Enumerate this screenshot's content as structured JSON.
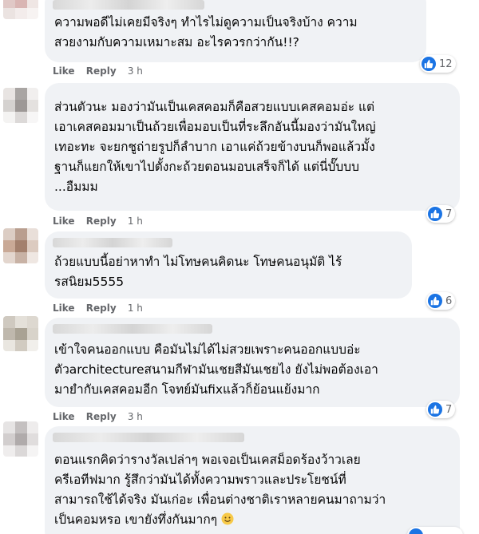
{
  "actions": {
    "like": "Like",
    "reply": "Reply"
  },
  "comments": [
    {
      "text": "ความพอดีไม่เคยมีจริงๆ ทำไรไม่ดูความเป็นจริงบ้าง ความ\nสวยงามกับความเหมาะสม อะไรควรกว่ากัน!!?",
      "time": "3 h",
      "likes": "12"
    },
    {
      "text": "ส่วนตัวนะ มองว่ามันเป็นเคสคอมก็คือสวยแบบเคสคอมอ่ะ แต่\nเอาเคสคอมมาเป็นถ้วยเพื่อมอบเป็นที่ระลึกอันนี้มองว่ามันใหญ่\nเทอะทะ จะยกชูถ่ายรูปก็ลำบาก เอาแค่ถ้วยข้างบนก็พอแล้วมั้ง\nฐานก็แยกให้เขาไปตั้งกะถ้วยตอนมอบเสร็จก็ได้ แต่นี่บั๊บบบ\n...อืมมม",
      "time": "1 h",
      "likes": "7"
    },
    {
      "text": "ถ้วยแบบนี้อย่าหาทำ ไม่โทษคนคิดนะ โทษคนอนุมัติ ไร้\nรสนิยม5555",
      "time": "1 h",
      "likes": "6"
    },
    {
      "text": "เข้าใจคนออกแบบ คือมันไม่ได้ไม่สวยเพราะคนออกแบบอ่ะ\nตัวarchitectureสนามกีฬามันเชยสีมันเชยไง ยังไม่พอต้องเอา\nมายำกับเคสคอมอีก โจทย์มันfixแล้วก็ย้อนแย้งมาก",
      "time": "3 h",
      "likes": "7"
    },
    {
      "text": "ตอนแรกคิดว่ารางวัลเปล่าๆ พอเจอเป็นเคสม็อดร้องว้าวเลย\nครีเอทีฟมาก รู้สึกว่ามันได้ทั้งความพราวและประโยชน์ที่\nสามารถใช้ได้จริง มันเก่อะ เพื่อนต่างชาติเราหลายคนมาถามว่า\nเป็นคอมหรอ เขายังทึ่งกันมากๆ",
      "emoji": "smiling-face-emoji"
    }
  ],
  "colors": {
    "bubble": "#f0f2f5",
    "like_blue": "#1b74e4",
    "meta": "#65676b"
  }
}
